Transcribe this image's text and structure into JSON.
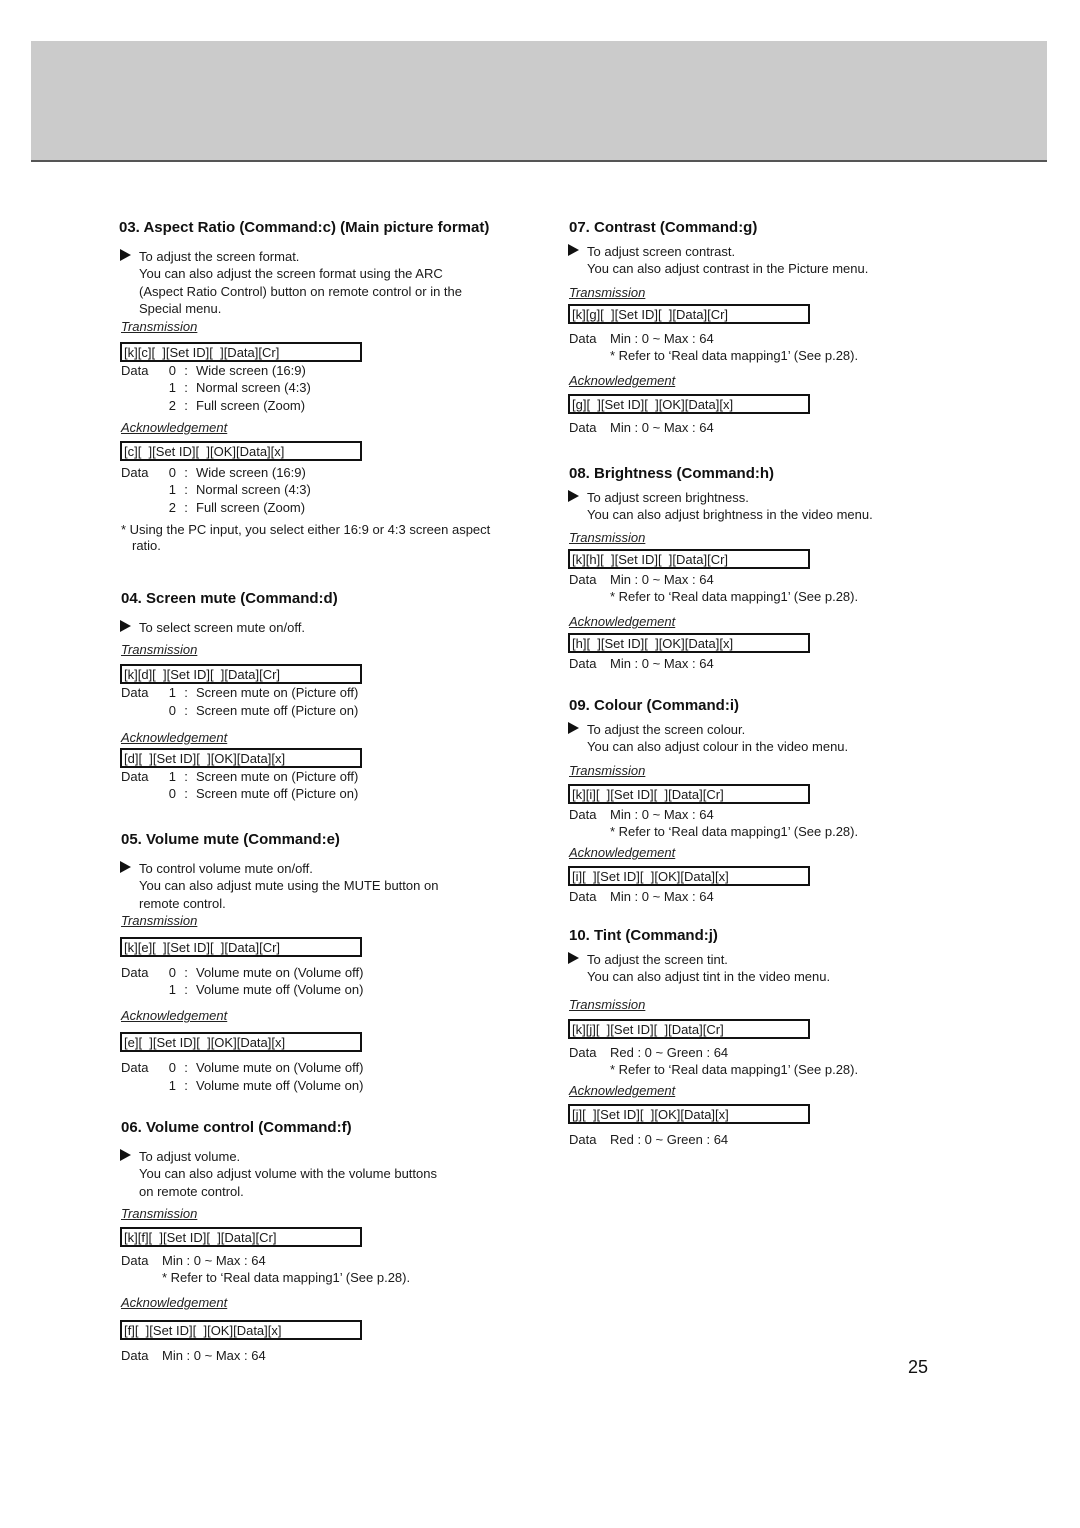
{
  "page_number": "25",
  "labels": {
    "transmission": "Transmission",
    "acknowledgement": "Acknowledgement",
    "data": "Data"
  },
  "sections": {
    "s03": {
      "title": "03. Aspect Ratio (Command:c) (Main picture format)",
      "desc": [
        "To adjust the screen format.",
        "You can also adjust the screen format using the ARC",
        "(Aspect Ratio Control) button on remote control or in the",
        "Special menu."
      ],
      "tx": "[k][c][  ][Set ID][  ][Data][Cr]",
      "tx_data": [
        {
          "v": "0",
          "t": "Wide screen (16:9)"
        },
        {
          "v": "1",
          "t": "Normal screen (4:3)"
        },
        {
          "v": "2",
          "t": "Full screen (Zoom)"
        }
      ],
      "ack": "[c][  ][Set ID][  ][OK][Data][x]",
      "ack_data": [
        {
          "v": "0",
          "t": "Wide screen (16:9)"
        },
        {
          "v": "1",
          "t": "Normal screen (4:3)"
        },
        {
          "v": "2",
          "t": "Full screen (Zoom)"
        }
      ],
      "note": "* Using the PC input, you select either 16:9 or 4:3 screen aspect ratio."
    },
    "s04": {
      "title": "04. Screen mute (Command:d)",
      "desc": [
        "To select screen mute on/off."
      ],
      "tx": "[k][d][  ][Set ID][  ][Data][Cr]",
      "tx_data": [
        {
          "v": "1",
          "t": "Screen mute on (Picture off)"
        },
        {
          "v": "0",
          "t": "Screen mute off (Picture on)"
        }
      ],
      "ack": "[d][  ][Set ID][  ][OK][Data][x]",
      "ack_data": [
        {
          "v": "1",
          "t": "Screen mute on (Picture off)"
        },
        {
          "v": "0",
          "t": "Screen mute off (Picture on)"
        }
      ]
    },
    "s05": {
      "title": "05. Volume mute (Command:e)",
      "desc": [
        "To control volume mute on/off.",
        "You can also adjust mute using the MUTE button on",
        "remote control."
      ],
      "tx": "[k][e][  ][Set ID][  ][Data][Cr]",
      "tx_data": [
        {
          "v": "0",
          "t": "Volume mute on (Volume off)"
        },
        {
          "v": "1",
          "t": "Volume mute off (Volume on)"
        }
      ],
      "ack": "[e][  ][Set ID][  ][OK][Data][x]",
      "ack_data": [
        {
          "v": "0",
          "t": "Volume mute on (Volume off)"
        },
        {
          "v": "1",
          "t": "Volume mute off (Volume on)"
        }
      ]
    },
    "s06": {
      "title": "06. Volume control (Command:f)",
      "desc": [
        "To adjust volume.",
        "You can also adjust volume with the volume buttons",
        "on remote control."
      ],
      "tx": "[k][f][  ][Set ID][  ][Data][Cr]",
      "tx_range": "Min : 0 ~ Max : 64",
      "tx_note": "* Refer to ‘Real data mapping1’ (See p.28).",
      "ack": "[f][  ][Set ID][  ][OK][Data][x]",
      "ack_range": "Min : 0 ~ Max : 64"
    },
    "s07": {
      "title": "07. Contrast (Command:g)",
      "desc": [
        "To adjust screen contrast.",
        "You can also adjust contrast in the Picture menu."
      ],
      "tx": "[k][g][  ][Set ID][  ][Data][Cr]",
      "tx_range": "Min : 0 ~ Max : 64",
      "tx_note": "* Refer to ‘Real data mapping1’ (See p.28).",
      "ack": "[g][  ][Set ID][  ][OK][Data][x]",
      "ack_range": "Min : 0 ~ Max : 64"
    },
    "s08": {
      "title": "08. Brightness (Command:h)",
      "desc": [
        "To adjust screen brightness.",
        "You can also adjust brightness in the video menu."
      ],
      "tx": "[k][h][  ][Set ID][  ][Data][Cr]",
      "tx_range": "Min : 0 ~ Max : 64",
      "tx_note": "* Refer to ‘Real data mapping1’ (See p.28).",
      "ack": "[h][  ][Set ID][  ][OK][Data][x]",
      "ack_range": "Min : 0 ~ Max : 64"
    },
    "s09": {
      "title": "09. Colour (Command:i)",
      "desc": [
        "To adjust the screen colour.",
        "You can also adjust colour in the video menu."
      ],
      "tx": "[k][i][  ][Set ID][  ][Data][Cr]",
      "tx_range": "Min : 0 ~ Max : 64",
      "tx_note": "* Refer to ‘Real data mapping1’ (See p.28).",
      "ack": "[i][  ][Set ID][  ][OK][Data][x]",
      "ack_range": "Min : 0 ~ Max : 64"
    },
    "s10": {
      "title": "10. Tint (Command:j)",
      "desc": [
        "To adjust the screen tint.",
        "You can also adjust tint in the video menu."
      ],
      "tx": "[k][j][  ][Set ID][  ][Data][Cr]",
      "tx_range": "Red : 0 ~ Green : 64",
      "tx_note": "* Refer to ‘Real data mapping1’ (See p.28).",
      "ack": "[j][  ][Set ID][  ][OK][Data][x]",
      "ack_range": "Red : 0 ~ Green : 64"
    }
  }
}
